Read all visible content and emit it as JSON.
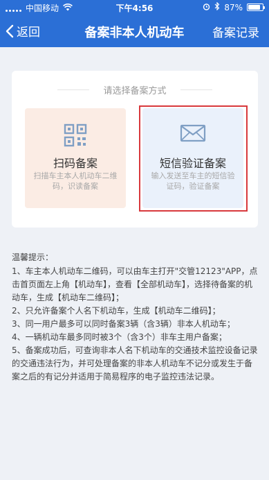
{
  "status_bar": {
    "carrier": "中国移动",
    "time": "下午4:56",
    "battery": "87%",
    "battery_level": 0.87
  },
  "nav": {
    "back_label": "返回",
    "title": "备案非本人机动车",
    "right_label": "备案记录"
  },
  "card": {
    "hint": "请选择备案方式",
    "options": [
      {
        "icon": "qr-code-icon",
        "title": "扫码备案",
        "desc": "扫描车主本人机动车二维码，识读备案"
      },
      {
        "icon": "envelope-icon",
        "title": "短信验证备案",
        "desc": "输入发送至车主的短信验证码，验证备案"
      }
    ]
  },
  "tips": {
    "title": "温馨提示：",
    "items": [
      "1、车主本人机动车二维码，可以由车主打开\"交管12123\"APP，点击首页面左上角【机动车】，查看【全部机动车】，选择待备案的机动车，生成【机动车二维码】；",
      "2、只允许备案个人名下机动车，生成【机动车二维码】；",
      "3、同一用户最多可以同时备案3辆（含3辆）非本人机动车；",
      "4、一辆机动车最多同时被3个（含3个）非车主用户备案；",
      "5、备案成功后，可查询非本人名下机动车的交通技术监控设备记录的交通违法行为，并可处理备案的非本人机动车不记分或发生于备案之后的有记分并适用于简易程序的电子监控违法记录。"
    ]
  },
  "colors": {
    "header_bg": "#2b6fd6",
    "page_bg": "#eef1f6",
    "qr_option_bg": "#fbece4",
    "sms_option_bg": "#eaf1fb",
    "highlight_border": "#d8383c",
    "icon_color": "#7f9fc4"
  }
}
